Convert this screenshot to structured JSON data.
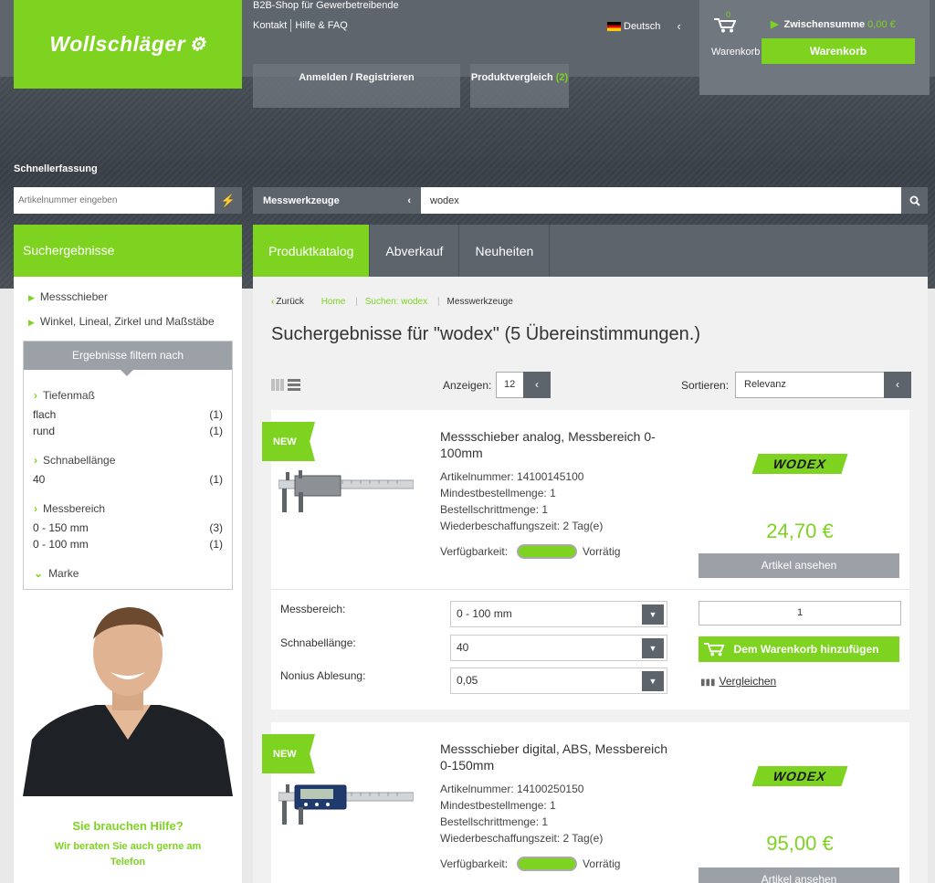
{
  "header": {
    "logo_text": "Wollschläger",
    "b2b": "B2B-Shop für Gewerbetreibende",
    "contact": "Kontakt",
    "help": "Hilfe & FAQ",
    "language": "Deutsch",
    "login": "Anmelden / Registrieren",
    "compare_label": "Produktvergleich",
    "compare_count": "(2)",
    "cart": {
      "count": "0",
      "label": "Warenkorb",
      "subtotal_label": "Zwischensumme",
      "subtotal_value": "0,00 €",
      "button": "Warenkorb"
    }
  },
  "quick_entry": {
    "title": "Schnellerfassung",
    "placeholder": "Artikelnummer eingeben"
  },
  "search": {
    "category": "Messwerkzeuge",
    "query": "wodex"
  },
  "sidebar": {
    "title": "Suchergebnisse",
    "links": [
      "Messschieber",
      "Winkel, Lineal, Zirkel und Maßstäbe"
    ],
    "filter_title": "Ergebnisse filtern nach",
    "filters": [
      {
        "name": "Tiefenmaß",
        "options": [
          {
            "label": "flach",
            "count": "(1)"
          },
          {
            "label": "rund",
            "count": "(1)"
          }
        ]
      },
      {
        "name": "Schnabellänge",
        "options": [
          {
            "label": "40",
            "count": "(1)"
          }
        ]
      },
      {
        "name": "Messbereich",
        "options": [
          {
            "label": "0 - 150 mm",
            "count": "(3)"
          },
          {
            "label": "0 - 100 mm",
            "count": "(1)"
          }
        ]
      },
      {
        "name": "Marke",
        "options": []
      }
    ],
    "help_title": "Sie brauchen Hilfe?",
    "help_text": "Wir beraten Sie auch gerne am Telefon"
  },
  "nav": {
    "tabs": [
      "Produktkatalog",
      "Abverkauf",
      "Neuheiten"
    ],
    "active": "Produktkatalog"
  },
  "breadcrumb": {
    "back": "Zurück",
    "items": [
      "Home",
      "Suchen: wodex",
      "Messwerkzeuge"
    ]
  },
  "results": {
    "title": "Suchergebnisse für \"wodex\" (5 Übereinstimmungen.)",
    "show_label": "Anzeigen:",
    "show_value": "12",
    "sort_label": "Sortieren:",
    "sort_value": "Relevanz"
  },
  "products": [
    {
      "badge": "NEW",
      "title": "Messschieber analog, Messbereich 0-100mm",
      "article": "Artikelnummer: 14100145100",
      "min_qty": "Mindestbestellmenge: 1",
      "step_qty": "Bestellschrittmenge: 1",
      "lead_time": "Wiederbeschaffungszeit: 2 Tag(e)",
      "availability_label": "Verfügbarkeit:",
      "availability_value": "Vorrätig",
      "brand": "WODEX",
      "price": "24,70 €",
      "view_button": "Artikel ansehen",
      "options": [
        {
          "label": "Messbereich:",
          "value": "0 - 100 mm"
        },
        {
          "label": "Schnabellänge:",
          "value": "40"
        },
        {
          "label": "Nonius Ablesung:",
          "value": "0,05"
        }
      ],
      "quantity": "1",
      "add_to_cart": "Dem Warenkorb hinzufügen",
      "compare": "Vergleichen"
    },
    {
      "badge": "NEW",
      "title": "Messschieber digital, ABS, Messbereich 0-150mm",
      "article": "Artikelnummer: 14100250150",
      "min_qty": "Mindestbestellmenge: 1",
      "step_qty": "Bestellschrittmenge: 1",
      "lead_time": "Wiederbeschaffungszeit: 2 Tag(e)",
      "availability_label": "Verfügbarkeit:",
      "availability_value": "Vorrätig",
      "brand": "WODEX",
      "price": "95,00 €",
      "view_button": "Artikel ansehen"
    }
  ],
  "colors": {
    "accent": "#7ed321",
    "dark": "#5d646b",
    "gray_button": "#9ca1a7"
  }
}
